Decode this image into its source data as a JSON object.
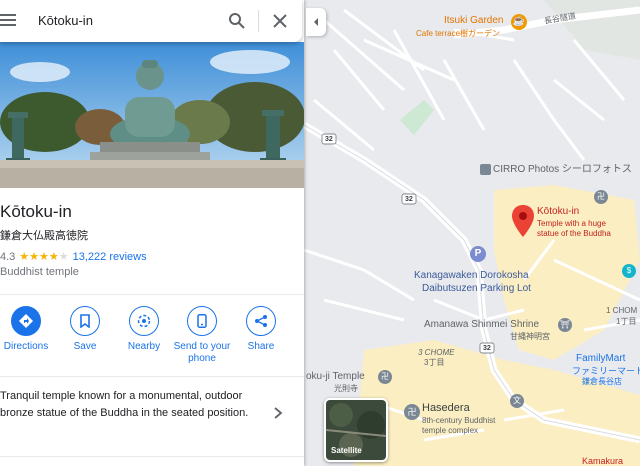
{
  "search": {
    "query": "Kōtoku-in"
  },
  "place": {
    "name": "Kōtoku-in",
    "local_name": "鎌倉大仏殿高徳院",
    "rating": "4.3",
    "reviews": "13,222 reviews",
    "category": "Buddhist temple",
    "description": "Tranquil temple known for a monumental, outdoor bronze statue of the Buddha in the seated position."
  },
  "actions": [
    {
      "label": "Directions",
      "icon": "directions-icon"
    },
    {
      "label": "Save",
      "icon": "bookmark-icon"
    },
    {
      "label": "Nearby",
      "icon": "nearby-icon"
    },
    {
      "label": "Send to your phone",
      "icon": "phone-icon"
    },
    {
      "label": "Share",
      "icon": "share-icon"
    }
  ],
  "map": {
    "itsuki_name": "Itsuki Garden",
    "itsuki_sub": "Cafe terrace樹ガーデン",
    "road_top": "長谷隧道",
    "cirro": "CIRRO Photos シーロフォトス",
    "kotoku_name": "Kōtoku-in",
    "kotoku_sub1": "Temple with a huge",
    "kotoku_sub2": "statue of the Buddha",
    "parking1": "Kanagawaken Dorokosha",
    "parking2": "Daibutsuzen Parking Lot",
    "amanawa1": "Amanawa Shinmei Shrine",
    "amanawa2": "甘縄神明宮",
    "chome1": "3 CHOME",
    "chome2": "3丁目",
    "kojitemple1": "oku-ji Temple",
    "kojitemple2": "光則寺",
    "hasedera": "Hasedera",
    "hasedera_sub1": "8th-century Buddhist",
    "hasedera_sub2": "temple complex",
    "family1": "FamilyMart",
    "family2": "ファミリーマート",
    "family3": "鎌倉長谷店",
    "edge_1": "1 CHOM",
    "edge_2": "1丁目",
    "kamakura": "Kamakura",
    "road32a": "32",
    "road32b": "32",
    "road32c": "32",
    "satellite": "Satellite"
  },
  "colors": {
    "accent": "#1a73e8",
    "marker": "#ea4335",
    "star": "#f4b400"
  }
}
